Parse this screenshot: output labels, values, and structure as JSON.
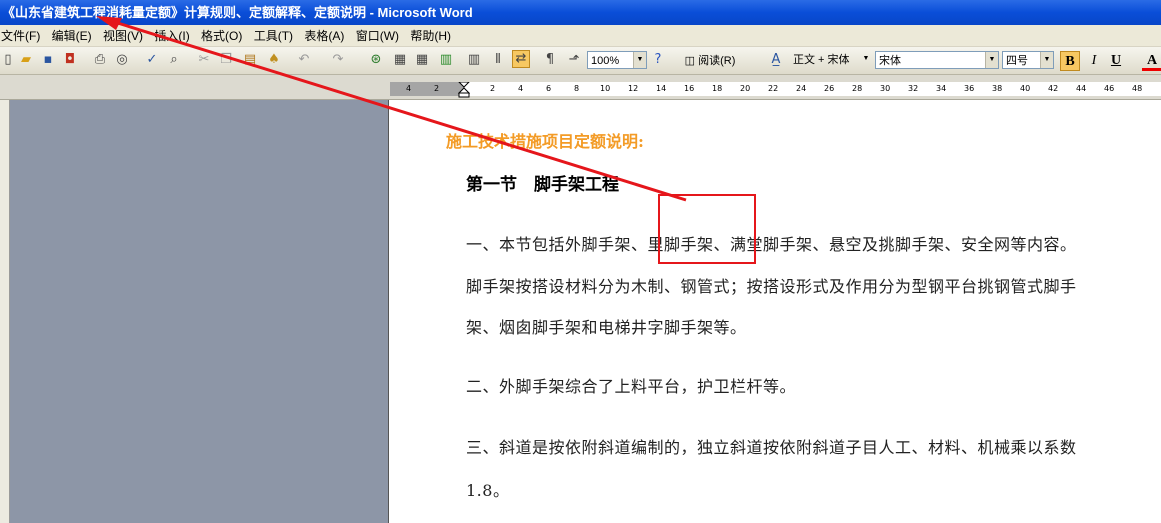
{
  "window": {
    "title": "《山东省建筑工程消耗量定额》计算规则、定额解释、定额说明 - Microsoft Word"
  },
  "menu": {
    "items": [
      "文件(F)",
      "编辑(E)",
      "视图(V)",
      "插入(I)",
      "格式(O)",
      "工具(T)",
      "表格(A)",
      "窗口(W)",
      "帮助(H)"
    ]
  },
  "toolbar": {
    "zoom": "100%",
    "read_label": "阅读(R)",
    "style": "正文 + 宋体",
    "font": "宋体",
    "size": "四号",
    "bold": "B",
    "italic": "I",
    "underline": "U",
    "font_color": "A"
  },
  "ruler": {
    "labels": [
      "4",
      "2",
      "2",
      "4",
      "6",
      "8",
      "10",
      "12",
      "14",
      "16",
      "18",
      "20",
      "22",
      "24",
      "26",
      "28",
      "30",
      "32",
      "34",
      "36",
      "38",
      "40",
      "42",
      "44",
      "46",
      "48"
    ]
  },
  "document": {
    "heading": "施工技术措施项目定额说明:",
    "section_title": "第一节　脚手架工程",
    "paragraphs": [
      "一、本节包括外脚手架、里脚手架、满堂脚手架、悬空及挑脚手架、安全网等内容。",
      "脚手架按搭设材料分为木制、钢管式；按搭设形式及作用分为型钢平台挑钢管式脚手",
      "架、烟囱脚手架和电梯井字脚手架等。",
      "二、外脚手架综合了上料平台，护卫栏杆等。",
      "三、斜道是按依附斜道编制的，独立斜道按依附斜道子目人工、材料、机械乘以系数",
      "1.8。"
    ]
  },
  "annotation": {
    "color": "#e5161b"
  },
  "icons": [
    "new-icon",
    "open-icon",
    "save-icon",
    "permission-icon",
    "print-icon",
    "print-preview-icon",
    "spelling-icon",
    "research-icon",
    "cut-icon",
    "copy-icon",
    "paste-icon",
    "format-painter-icon",
    "undo-icon",
    "redo-icon",
    "hyperlink-icon",
    "tables-borders-icon",
    "insert-table-icon",
    "insert-excel-icon",
    "columns-icon",
    "drawing-icon",
    "document-map-icon",
    "show-hide-icon",
    "help-icon",
    "styles-icon"
  ]
}
